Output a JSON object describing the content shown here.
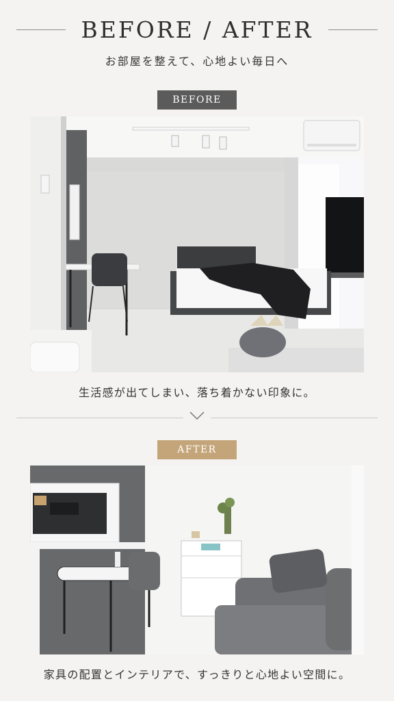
{
  "header": {
    "title": "BEFORE / AFTER",
    "subtitle": "お部屋を整えて、心地よい毎日へ"
  },
  "before": {
    "label": "BEFORE",
    "caption": "生活感が出てしまい、落ち着かない印象に。"
  },
  "after": {
    "label": "AFTER",
    "caption": "家具の配置とインテリアで、すっきりと心地よい空間に。"
  },
  "icons": {
    "divider": "chevron-down-icon"
  },
  "colors": {
    "background": "#f4f3f1",
    "before_badge": "#5b5b5b",
    "after_badge": "#c4a57a",
    "text": "#333333"
  }
}
